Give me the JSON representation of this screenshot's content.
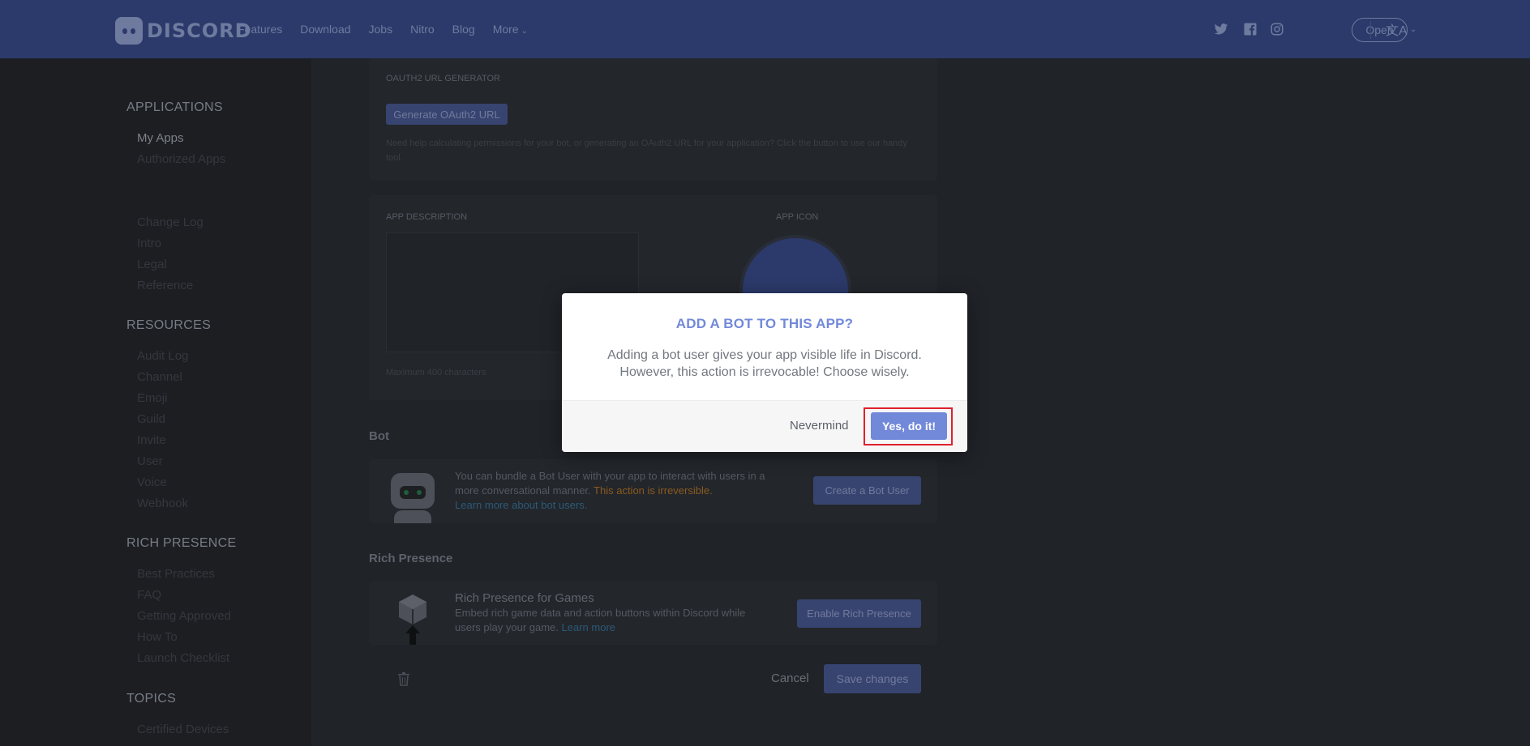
{
  "nav": {
    "brand": "DISCORD",
    "links": [
      "Features",
      "Download",
      "Jobs",
      "Nitro",
      "Blog"
    ],
    "more_label": "More",
    "more_chevron": "⌄",
    "open_label": "Open",
    "lang_icon": "文A",
    "lang_chevron": "⌄"
  },
  "sidebar": {
    "applications_title": "APPLICATIONS",
    "applications_items": [
      "My Apps",
      "Authorized Apps"
    ],
    "docs_items": [
      "Change Log",
      "Intro",
      "Legal",
      "Reference"
    ],
    "resources_title": "RESOURCES",
    "resources_items": [
      "Audit Log",
      "Channel",
      "Emoji",
      "Guild",
      "Invite",
      "User",
      "Voice",
      "Webhook"
    ],
    "rich_title": "RICH PRESENCE",
    "rich_items": [
      "Best Practices",
      "FAQ",
      "Getting Approved",
      "How To",
      "Launch Checklist"
    ],
    "topics_title": "TOPICS",
    "topics_items": [
      "Certified Devices"
    ]
  },
  "main": {
    "oauth_label": "OAUTH2 URL GENERATOR",
    "oauth_button": "Generate OAuth2 URL",
    "oauth_help": "Need help calculating permissions for your bot, or generating an OAuth2 URL for your application? Click the button to use our handy tool.",
    "desc_label": "APP DESCRIPTION",
    "icon_label": "APP ICON",
    "max_chars": "Maximum 400 characters",
    "bot_title": "Bot",
    "bot_text_1": "You can bundle a Bot User with your app to interact with users in a more conversational manner.",
    "bot_text_warn": "This action is irreversible.",
    "bot_link": "Learn more about bot users.",
    "bot_button": "Create a Bot User",
    "rich_title": "Rich Presence",
    "rich_heading": "Rich Presence for Games",
    "rich_text": "Embed rich game data and action buttons within Discord while users play your game.",
    "rich_link": "Learn more",
    "rich_button": "Enable Rich Presence",
    "cancel_label": "Cancel",
    "save_label": "Save changes"
  },
  "modal": {
    "title": "ADD A BOT TO THIS APP?",
    "body": "Adding a bot user gives your app visible life in Discord. However, this action is irrevocable! Choose wisely.",
    "nevermind_label": "Nevermind",
    "confirm_label": "Yes, do it!"
  },
  "colors": {
    "nav_bg": "#2c3a6b",
    "accent": "#7289da",
    "highlight": "#e0202c"
  }
}
